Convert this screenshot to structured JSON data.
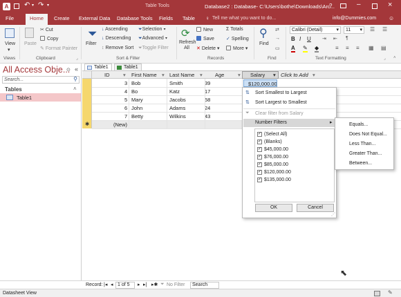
{
  "titlebar": {
    "context_tab": "Table Tools",
    "title": "Database2 : Database- C:\\Users\\bothe\\Downloads\\Arc...",
    "help": "?",
    "account": "info@Dummies.com",
    "tell_me": "Tell me what you want to do..."
  },
  "tabs": [
    "File",
    "Home",
    "Create",
    "External Data",
    "Database Tools",
    "Fields",
    "Table"
  ],
  "ribbon": {
    "view": "View",
    "paste": "Paste",
    "cut": "Cut",
    "copy": "Copy",
    "format_painter": "Format Painter",
    "filter": "Filter",
    "ascending": "Ascending",
    "descending": "Descending",
    "remove_sort": "Remove Sort",
    "selection": "Selection",
    "advanced": "Advanced",
    "toggle_filter": "Toggle Filter",
    "refresh_all": "Refresh All",
    "new": "New",
    "save": "Save",
    "delete": "Delete",
    "totals": "Totals",
    "spelling": "Spelling",
    "more": "More",
    "find": "Find",
    "font": "Calibri (Detail)",
    "font_size": "11",
    "bold": "B",
    "italic": "I",
    "underline": "U",
    "groups": [
      "Views",
      "Clipboard",
      "Sort & Filter",
      "Records",
      "Find",
      "Text Formatting"
    ]
  },
  "nav": {
    "title": "All Access Obje...",
    "search_placeholder": "Search...",
    "section": "Tables",
    "item": "Table1"
  },
  "doc_tabs": [
    "Table1",
    "Table1"
  ],
  "table": {
    "headers": [
      "ID",
      "First Name",
      "Last Name",
      "Age",
      "Salary",
      "Click to Add"
    ],
    "rows": [
      [
        "3",
        "Bob",
        "Smith",
        "39",
        "$120,000.00"
      ],
      [
        "4",
        "Bo",
        "Katz",
        "17",
        ""
      ],
      [
        "5",
        "Mary",
        "Jacobs",
        "58",
        ""
      ],
      [
        "6",
        "John",
        "Adams",
        "24",
        ""
      ],
      [
        "7",
        "Betty",
        "Wilkins",
        "43",
        ""
      ]
    ],
    "new_row": "(New)"
  },
  "dropdown": {
    "sort_asc": "Sort Smallest to Largest",
    "sort_desc": "Sort Largest to Smallest",
    "clear_filter": "Clear filter from Salary",
    "number_filters": "Number Filters",
    "values": [
      "(Select All)",
      "(Blanks)",
      "$45,000.00",
      "$76,000.00",
      "$85,000.00",
      "$120,000.00",
      "$135,000.00"
    ],
    "ok": "OK",
    "cancel": "Cancel"
  },
  "submenu": [
    "Equals...",
    "Does Not Equal...",
    "Less Than...",
    "Greater Than...",
    "Between..."
  ],
  "status": {
    "record_label": "Record:",
    "record_pos": "1 of 5",
    "no_filter": "No Filter",
    "search": "Search",
    "view": "Datasheet View"
  },
  "colors": {
    "brand": "#a4373a",
    "row_selector": "#f5d76e",
    "nav_selected": "#f4c7c9"
  }
}
